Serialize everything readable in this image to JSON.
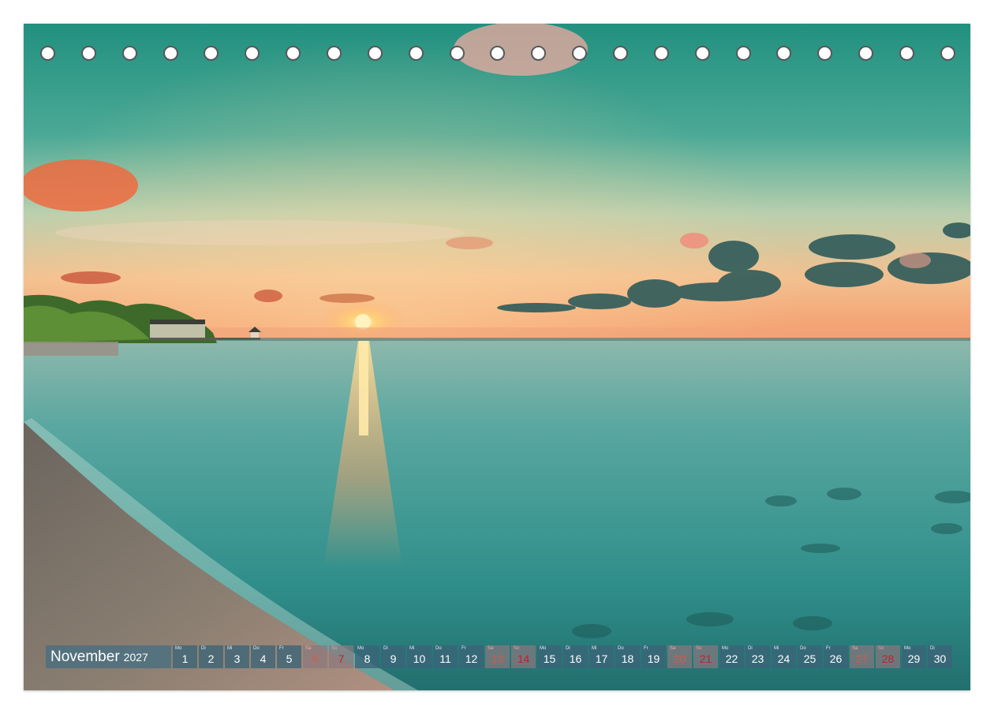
{
  "calendar": {
    "month": "November",
    "year": "2027",
    "days": [
      {
        "wd": "Mo",
        "num": "1",
        "type": "weekday"
      },
      {
        "wd": "Di",
        "num": "2",
        "type": "weekday"
      },
      {
        "wd": "Mi",
        "num": "3",
        "type": "weekday"
      },
      {
        "wd": "Do",
        "num": "4",
        "type": "weekday"
      },
      {
        "wd": "Fr",
        "num": "5",
        "type": "weekday"
      },
      {
        "wd": "Sa",
        "num": "6",
        "type": "sat"
      },
      {
        "wd": "So",
        "num": "7",
        "type": "sun"
      },
      {
        "wd": "Mo",
        "num": "8",
        "type": "weekday"
      },
      {
        "wd": "Di",
        "num": "9",
        "type": "weekday"
      },
      {
        "wd": "Mi",
        "num": "10",
        "type": "weekday"
      },
      {
        "wd": "Do",
        "num": "11",
        "type": "weekday"
      },
      {
        "wd": "Fr",
        "num": "12",
        "type": "weekday"
      },
      {
        "wd": "Sa",
        "num": "13",
        "type": "sat"
      },
      {
        "wd": "So",
        "num": "14",
        "type": "sun"
      },
      {
        "wd": "Mo",
        "num": "15",
        "type": "weekday"
      },
      {
        "wd": "Di",
        "num": "16",
        "type": "weekday"
      },
      {
        "wd": "Mi",
        "num": "17",
        "type": "weekday"
      },
      {
        "wd": "Do",
        "num": "18",
        "type": "weekday"
      },
      {
        "wd": "Fr",
        "num": "19",
        "type": "weekday"
      },
      {
        "wd": "Sa",
        "num": "20",
        "type": "sat"
      },
      {
        "wd": "So",
        "num": "21",
        "type": "sun"
      },
      {
        "wd": "Mo",
        "num": "22",
        "type": "weekday"
      },
      {
        "wd": "Di",
        "num": "23",
        "type": "weekday"
      },
      {
        "wd": "Mi",
        "num": "24",
        "type": "weekday"
      },
      {
        "wd": "Do",
        "num": "25",
        "type": "weekday"
      },
      {
        "wd": "Fr",
        "num": "26",
        "type": "weekday"
      },
      {
        "wd": "Sa",
        "num": "27",
        "type": "sat"
      },
      {
        "wd": "So",
        "num": "28",
        "type": "sun"
      },
      {
        "wd": "Mo",
        "num": "29",
        "type": "weekday"
      },
      {
        "wd": "Di",
        "num": "30",
        "type": "weekday"
      }
    ]
  },
  "binding": {
    "hole_count": 23
  },
  "colors": {
    "sky_top": "#2f9a8a",
    "sky_mid": "#9cc8b0",
    "horizon": "#f6a677",
    "sun": "#ffe08a",
    "water": "#3c9c95",
    "sand": "#8a7f74"
  }
}
